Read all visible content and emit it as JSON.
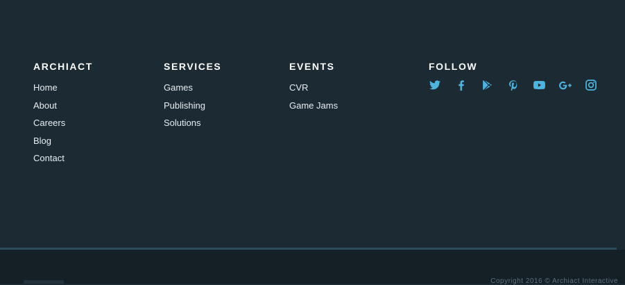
{
  "colors": {
    "background": "#1c2a33",
    "bottom_bar": "#141f26",
    "divider": "#2c4d60",
    "social_icon": "#4fb3e0",
    "heading": "#ffffff",
    "link": "#e8eef2",
    "copyright": "#5f7280"
  },
  "columns": {
    "archiact": {
      "heading": "ARCHIACT",
      "links": [
        "Home",
        "About",
        "Careers",
        "Blog",
        "Contact"
      ]
    },
    "services": {
      "heading": "SERVICES",
      "links": [
        "Games",
        "Publishing",
        "Solutions"
      ]
    },
    "events": {
      "heading": "EVENTS",
      "links": [
        "CVR",
        "Game Jams"
      ]
    },
    "follow": {
      "heading": "FOLLOW",
      "icons": [
        "twitter-icon",
        "facebook-icon",
        "google-play-icon",
        "pinterest-icon",
        "youtube-icon",
        "google-plus-icon",
        "instagram-icon"
      ]
    }
  },
  "bottom": {
    "copyright": "Copyright 2016 © Archiact Interactive"
  }
}
